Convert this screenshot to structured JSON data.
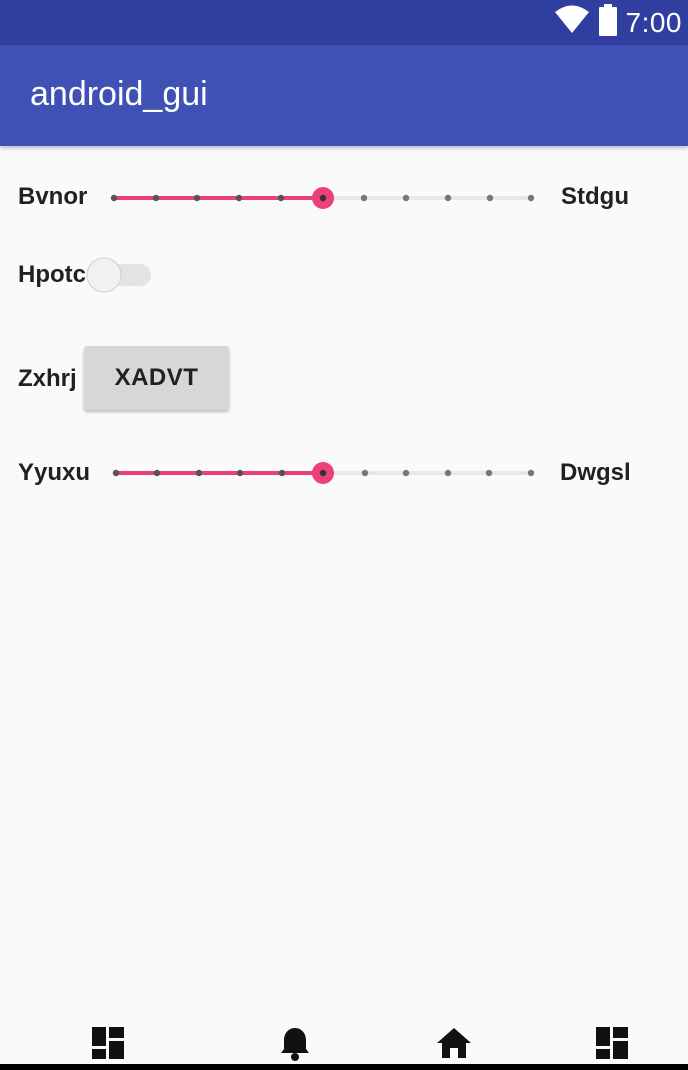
{
  "status_bar": {
    "time": "7:00",
    "wifi_icon": "wifi-icon",
    "battery_icon": "battery-icon",
    "color": "#303f9f"
  },
  "app_bar": {
    "title": "android_gui",
    "color": "#3f51b5"
  },
  "accent": "#ec407a",
  "rows": {
    "slider1": {
      "left_label": "Bvnor",
      "right_label": "Stdgu",
      "value": 5,
      "max": 10
    },
    "toggle": {
      "label": "Hpotc",
      "checked": false
    },
    "button_row": {
      "label": "Zxhrj",
      "button": "XADVT"
    },
    "slider2": {
      "left_label": "Yyuxu",
      "right_label": "Dwgsl",
      "value": 5,
      "max": 10
    }
  },
  "bottom_nav": {
    "items": [
      {
        "icon": "dashboard-icon"
      },
      {
        "icon": "bell-icon"
      },
      {
        "icon": "home-icon"
      },
      {
        "icon": "dashboard-icon"
      }
    ]
  }
}
